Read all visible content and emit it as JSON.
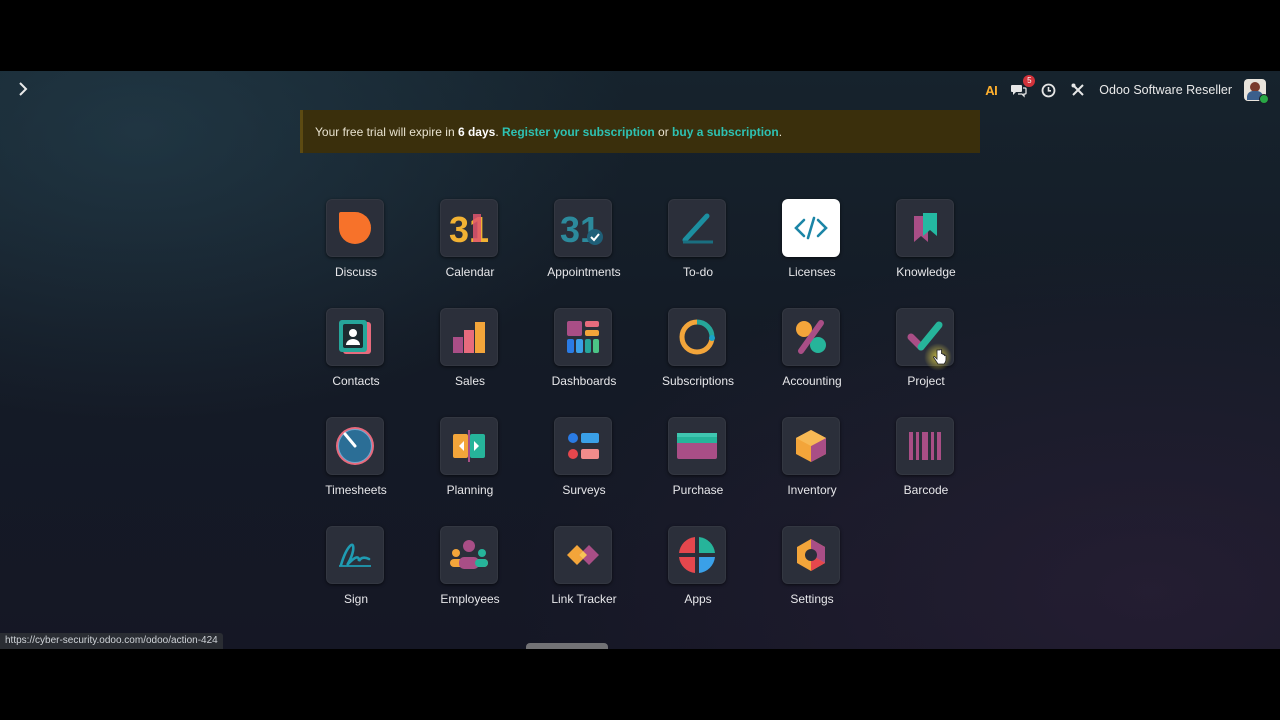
{
  "topbar": {
    "ai_label_a": "A",
    "ai_label_i": "I",
    "chat_count": "5",
    "company_name": "Odoo Software Reseller"
  },
  "trial": {
    "prefix": "Your free trial will expire in ",
    "days": "6 days",
    "dot": ". ",
    "register_link": "Register your subscription",
    "or": " or ",
    "buy_link": "buy a subscription",
    "end": "."
  },
  "apps": [
    {
      "label": "Discuss",
      "icon": "discuss-icon"
    },
    {
      "label": "Calendar",
      "icon": "calendar-icon",
      "glyph": "31"
    },
    {
      "label": "Appointments",
      "icon": "appointments-icon",
      "glyph": "31"
    },
    {
      "label": "To-do",
      "icon": "todo-icon"
    },
    {
      "label": "Licenses",
      "icon": "code-icon",
      "glyph": "</>"
    },
    {
      "label": "Knowledge",
      "icon": "knowledge-icon"
    },
    {
      "label": "Contacts",
      "icon": "contacts-icon"
    },
    {
      "label": "Sales",
      "icon": "sales-icon"
    },
    {
      "label": "Dashboards",
      "icon": "dashboards-icon"
    },
    {
      "label": "Subscriptions",
      "icon": "subscriptions-icon"
    },
    {
      "label": "Accounting",
      "icon": "accounting-icon"
    },
    {
      "label": "Project",
      "icon": "project-icon"
    },
    {
      "label": "Timesheets",
      "icon": "timesheets-icon"
    },
    {
      "label": "Planning",
      "icon": "planning-icon"
    },
    {
      "label": "Surveys",
      "icon": "surveys-icon"
    },
    {
      "label": "Purchase",
      "icon": "purchase-icon"
    },
    {
      "label": "Inventory",
      "icon": "inventory-icon"
    },
    {
      "label": "Barcode",
      "icon": "barcode-icon"
    },
    {
      "label": "Sign",
      "icon": "sign-icon"
    },
    {
      "label": "Employees",
      "icon": "employees-icon"
    },
    {
      "label": "Link Tracker",
      "icon": "link-tracker-icon"
    },
    {
      "label": "Apps",
      "icon": "apps-icon"
    },
    {
      "label": "Settings",
      "icon": "settings-icon"
    }
  ],
  "statusbar": {
    "url": "https://cyber-security.odoo.com/odoo/action-424"
  },
  "colors": {
    "accent_link": "#2ec2b3",
    "trial_bg": "#3a2f0c",
    "tile_bg": "#2b2f3a"
  }
}
